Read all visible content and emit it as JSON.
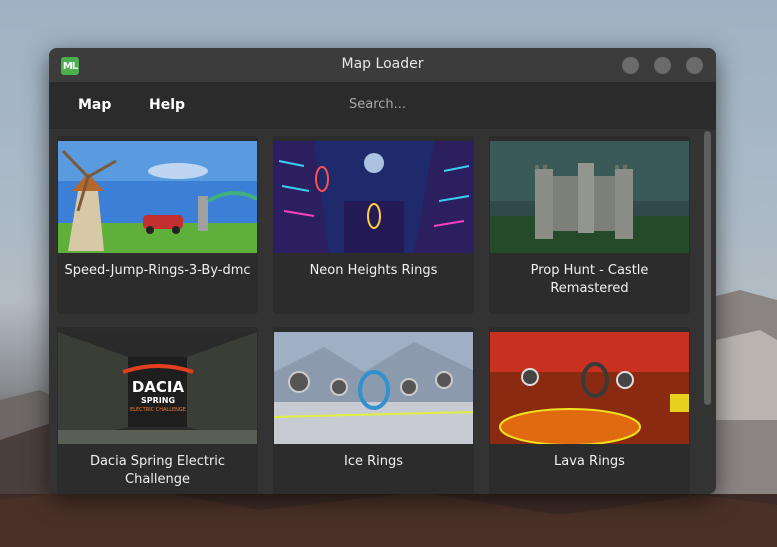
{
  "window": {
    "title": "Map Loader",
    "app_icon": "ML",
    "controls": [
      "minimize-button",
      "maximize-button",
      "close-button"
    ]
  },
  "menu": {
    "items": [
      "Map",
      "Help"
    ],
    "search_placeholder": "Search..."
  },
  "maps": [
    {
      "name": "Speed-Jump-Rings-3-By-dmc"
    },
    {
      "name": "Neon Heights Rings"
    },
    {
      "name": "Prop Hunt - Castle Remastered"
    },
    {
      "name": "Dacia Spring Electric Challenge",
      "thumb_text": "DACIA",
      "thumb_subtext": "SPRING",
      "thumb_caption": "ELECTRIC CHALLENGE"
    },
    {
      "name": "Ice Rings"
    },
    {
      "name": "Lava Rings"
    }
  ],
  "colors": {
    "window_bg": "#2b2b2b",
    "titlebar_bg": "#3c3c3c",
    "card_bg": "#2c2c2c",
    "app_icon_green": "#4caf50"
  }
}
